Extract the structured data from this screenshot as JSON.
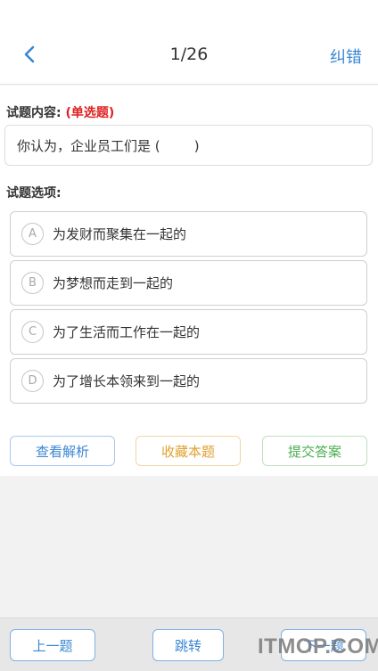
{
  "header": {
    "page_counter": "1/26",
    "report_label": "纠错"
  },
  "question": {
    "content_label": "试题内容:",
    "type_tag": "(单选题)",
    "text": "你认为，企业员工们是 (        )",
    "options_label": "试题选项:",
    "options": [
      {
        "letter": "A",
        "text": "为发财而聚集在一起的"
      },
      {
        "letter": "B",
        "text": "为梦想而走到一起的"
      },
      {
        "letter": "C",
        "text": "为了生活而工作在一起的"
      },
      {
        "letter": "D",
        "text": "为了增长本领来到一起的"
      }
    ]
  },
  "actions": {
    "analysis_label": "查看解析",
    "favorite_label": "收藏本题",
    "submit_label": "提交答案"
  },
  "footer": {
    "prev_label": "上一题",
    "jump_label": "跳转",
    "next_label": "下一题"
  },
  "watermark": "ITMOP.COM",
  "colors": {
    "accent_blue": "#3a86d4",
    "tag_red": "#e02020",
    "analysis_border": "#a9c8ee",
    "favorite_text": "#e0a030",
    "favorite_border": "#f2d5a4",
    "submit_text": "#4caf50",
    "submit_border": "#bfe0c1"
  },
  "icons": {
    "back": "chevron-left-icon"
  }
}
